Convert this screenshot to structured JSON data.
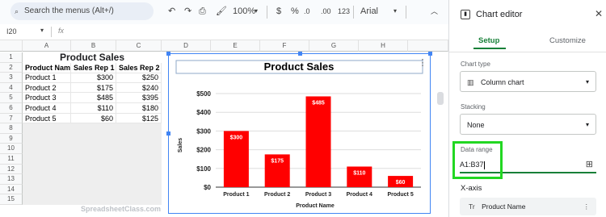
{
  "toolbar": {
    "search_placeholder": "Search the menus (Alt+/)",
    "zoom": "100%",
    "currency": "$",
    "percent": "%",
    "dec_decrease": ".0",
    "dec_increase": ".00",
    "number_format": "123",
    "font": "Arial"
  },
  "formula_bar": {
    "cell_ref": "I20",
    "fx": "fx"
  },
  "columns": [
    "A",
    "B",
    "C",
    "D",
    "E",
    "F",
    "G",
    "H"
  ],
  "rows": [
    "1",
    "2",
    "3",
    "4",
    "5",
    "6",
    "7",
    "8",
    "9",
    "10",
    "11",
    "12",
    "13",
    "14",
    "15"
  ],
  "sheet": {
    "title": "Product Sales",
    "headers": [
      "Product Name",
      "Sales Rep 1",
      "Sales Rep 2"
    ],
    "data": [
      [
        "Product 1",
        "$300",
        "$250"
      ],
      [
        "Product 2",
        "$175",
        "$240"
      ],
      [
        "Product 3",
        "$485",
        "$395"
      ],
      [
        "Product 4",
        "$110",
        "$180"
      ],
      [
        "Product 5",
        "$60",
        "$125"
      ]
    ]
  },
  "watermark": "SpreadsheetClass.com",
  "chart_data": {
    "type": "bar",
    "title": "Product Sales",
    "categories": [
      "Product 1",
      "Product 2",
      "Product 3",
      "Product 4",
      "Product 5"
    ],
    "values": [
      300,
      175,
      485,
      110,
      60
    ],
    "data_labels": [
      "$300",
      "$175",
      "$485",
      "$110",
      "$60"
    ],
    "xlabel": "Product Name",
    "ylabel": "Sales",
    "ylim": [
      0,
      500
    ],
    "yticks": [
      "$0",
      "$100",
      "$200",
      "$300",
      "$400",
      "$500"
    ],
    "bar_color": "#ff0000",
    "grid": true
  },
  "editor": {
    "title": "Chart editor",
    "tabs": [
      "Setup",
      "Customize"
    ],
    "chart_type_label": "Chart type",
    "chart_type_value": "Column chart",
    "stacking_label": "Stacking",
    "stacking_value": "None",
    "data_range_label": "Data range",
    "data_range_value": "A1:B37",
    "xaxis_label": "X-axis",
    "xaxis_value": "Product Name",
    "highlight_color": "#22d722",
    "accent": "#188038"
  }
}
